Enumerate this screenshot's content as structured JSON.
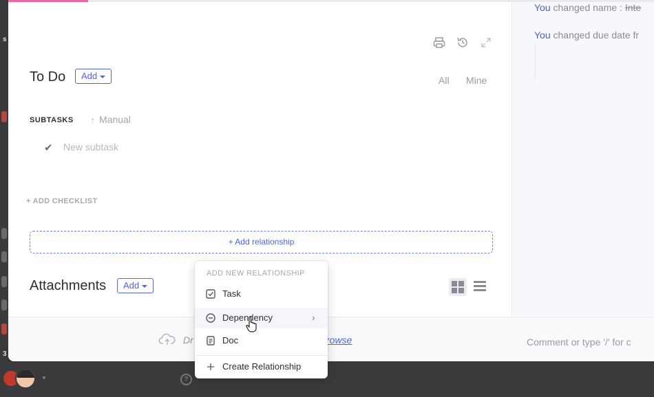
{
  "activity": {
    "line1": {
      "actor": "You",
      "text": "changed name :",
      "old_value": "Inte"
    },
    "line2": {
      "actor": "You",
      "text": "changed due date fr"
    }
  },
  "header_icons": [
    "print-icon",
    "history-icon",
    "expand-icon"
  ],
  "todo": {
    "title": "To Do",
    "add_label": "Add",
    "filter_all": "All",
    "filter_mine": "Mine"
  },
  "subtasks": {
    "label": "SUBTASKS",
    "sort_label": "Manual",
    "new_placeholder": "New subtask"
  },
  "checklist": {
    "add_label": "+ ADD CHECKLIST"
  },
  "relationship": {
    "add_label": "+ Add relationship"
  },
  "attachments": {
    "title": "Attachments",
    "add_label": "Add",
    "drop_text": "Dr",
    "browse_text": "rowse"
  },
  "comment": {
    "placeholder": "Comment or type '/' for c"
  },
  "menu": {
    "header": "ADD NEW RELATIONSHIP",
    "items": [
      {
        "label": "Task",
        "icon": "checkbox-icon"
      },
      {
        "label": "Dependency",
        "icon": "minus-circle-icon",
        "has_submenu": true
      },
      {
        "label": "Doc",
        "icon": "document-icon"
      },
      {
        "label": "Create Relationship",
        "icon": "plus-icon"
      }
    ]
  },
  "colors": {
    "accent": "#4f63e0",
    "pink_progress": "#e86ba8"
  }
}
